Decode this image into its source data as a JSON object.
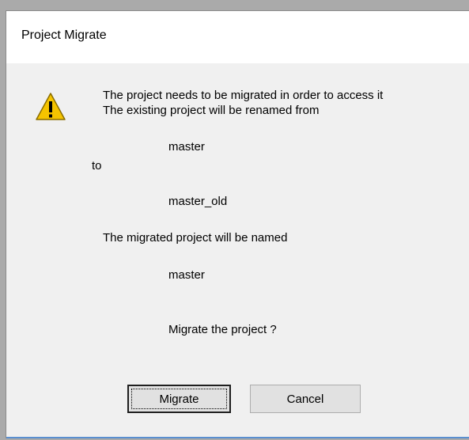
{
  "dialog": {
    "title": "Project Migrate",
    "icon": "warning-icon",
    "lines": {
      "intro_1": "The project needs to be migrated in order to access it",
      "intro_2": "The existing project will be renamed from",
      "old_name": "master",
      "to": "to",
      "new_old_name": "master_old",
      "migrated_label": "The migrated project will be named",
      "migrated_name": "master",
      "question": "Migrate the project ?"
    },
    "buttons": {
      "migrate": "Migrate",
      "cancel": "Cancel"
    },
    "colors": {
      "warning_fill": "#f5c400",
      "warning_border": "#8a6d00"
    }
  }
}
